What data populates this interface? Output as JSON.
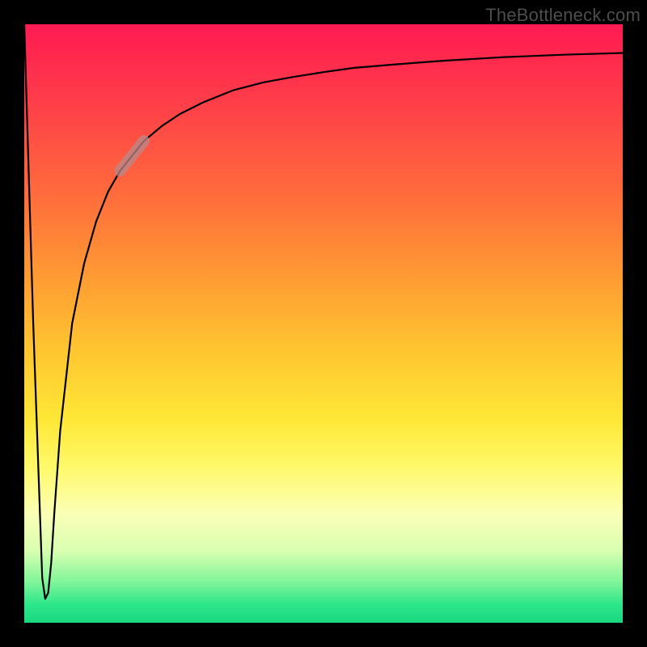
{
  "watermark": "TheBottleneck.com",
  "colors": {
    "frame": "#000000",
    "curve": "#000000",
    "marker": "#b88989",
    "gradient_top": "#ff1a52",
    "gradient_mid": "#ffe736",
    "gradient_bottom": "#18d880"
  },
  "chart_data": {
    "type": "line",
    "title": "",
    "xlabel": "",
    "ylabel": "",
    "xlim": [
      0,
      100
    ],
    "ylim": [
      0,
      100
    ],
    "grid": false,
    "legend": false,
    "series": [
      {
        "name": "bottleneck-curve",
        "x": [
          0.0,
          1.5,
          3.0,
          3.5,
          4.0,
          4.5,
          5.0,
          6.0,
          8.0,
          10.0,
          12.0,
          14.0,
          16.0,
          18.0,
          20.0,
          23.0,
          26.0,
          30.0,
          35.0,
          40.0,
          45.0,
          50.0,
          55.0,
          62.0,
          70.0,
          80.0,
          90.0,
          100.0
        ],
        "y": [
          100.0,
          50.0,
          7.5,
          4.0,
          5.0,
          10.0,
          18.0,
          32.0,
          50.0,
          60.0,
          67.0,
          72.0,
          75.5,
          78.0,
          80.5,
          83.0,
          85.0,
          87.0,
          89.0,
          90.3,
          91.2,
          92.0,
          92.7,
          93.3,
          93.9,
          94.5,
          94.9,
          95.2
        ]
      }
    ],
    "marker": {
      "purpose": "highlighted-segment",
      "x_range": [
        16.0,
        20.0
      ],
      "y_range": [
        75.5,
        80.5
      ]
    },
    "background_gradient": {
      "direction": "vertical",
      "stops": [
        {
          "pos": 0.0,
          "color": "#ff1a52"
        },
        {
          "pos": 0.5,
          "color": "#ffc730"
        },
        {
          "pos": 0.78,
          "color": "#fff96a"
        },
        {
          "pos": 1.0,
          "color": "#18d880"
        }
      ]
    }
  }
}
